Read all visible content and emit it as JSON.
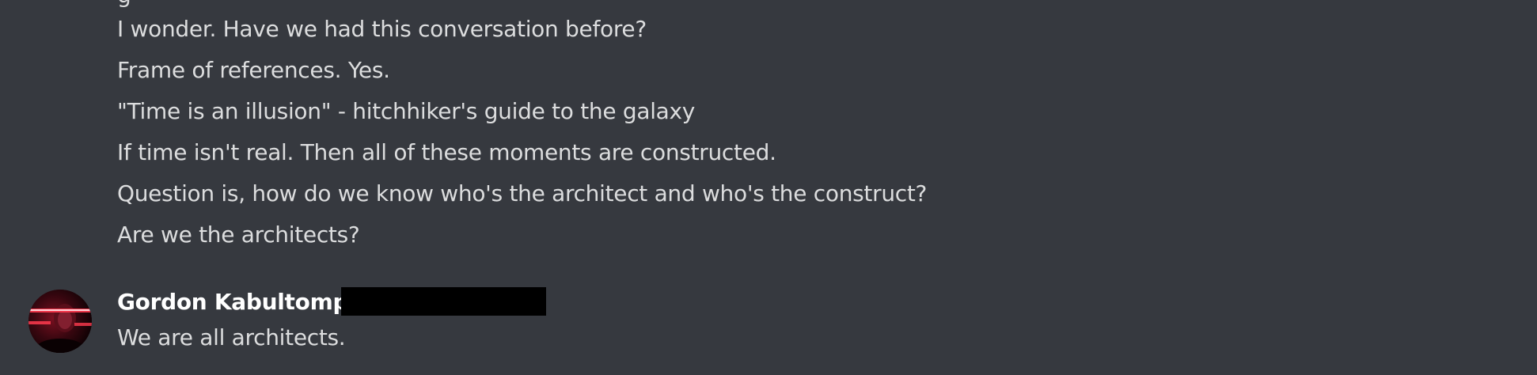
{
  "messages_group_1": {
    "lines": [
      "I wonder. Have we had this conversation before?",
      "Frame of references. Yes.",
      "\"Time is an illusion\" - hitchhiker's guide to the galaxy",
      "If time isn't real. Then all of these moments are constructed.",
      "Question is, how do we know who's the architect and who's the construct?",
      "Are we the architects?"
    ]
  },
  "messages_group_2": {
    "username": "Gordon Kabultompp",
    "message": "We are all architects."
  },
  "colors": {
    "background": "#36393f",
    "message_text": "#dcddde",
    "username_text": "#ffffff",
    "redaction": "#000000"
  }
}
